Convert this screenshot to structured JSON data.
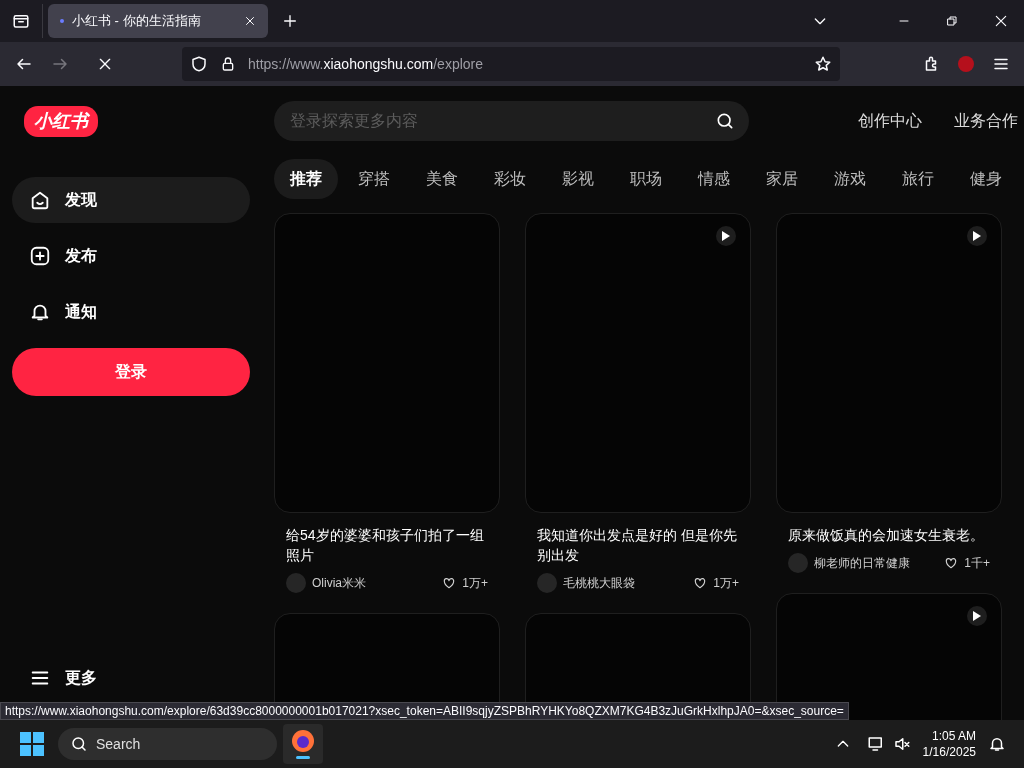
{
  "browser": {
    "tabs": [
      {
        "title": "小红书 - 你的生活指南",
        "selected": true,
        "loading": true
      }
    ],
    "url_prefix": "https://www.",
    "url_domain": "xiaohongshu.com",
    "url_path": "/explore",
    "status_url": "https://www.xiaohongshu.com/explore/63d39cc8000000001b017021?xsec_token=ABII9sqjyZSPBhRYHKYo8QZXM7KG4B3zJuGrkHxlhpJA0=&xsec_source="
  },
  "site": {
    "logo": "小红书",
    "search": {
      "placeholder": "登录探索更多内容"
    },
    "header_links": [
      "创作中心",
      "业务合作"
    ],
    "nav": [
      {
        "label": "发现",
        "kind": "discover",
        "selected": true
      },
      {
        "label": "发布",
        "kind": "publish",
        "selected": false
      },
      {
        "label": "通知",
        "kind": "notify",
        "selected": false
      }
    ],
    "login_button": "登录",
    "more": "更多",
    "channels": [
      {
        "label": "推荐",
        "selected": true
      },
      {
        "label": "穿搭",
        "selected": false
      },
      {
        "label": "美食",
        "selected": false
      },
      {
        "label": "彩妆",
        "selected": false
      },
      {
        "label": "影视",
        "selected": false
      },
      {
        "label": "职场",
        "selected": false
      },
      {
        "label": "情感",
        "selected": false
      },
      {
        "label": "家居",
        "selected": false
      },
      {
        "label": "游戏",
        "selected": false
      },
      {
        "label": "旅行",
        "selected": false
      },
      {
        "label": "健身",
        "selected": false
      }
    ],
    "columns": [
      [
        {
          "video": false,
          "title": "给54岁的婆婆和孩子们拍了一组照片",
          "author": "Olivia米米",
          "likes": "1万+"
        },
        {
          "video": false
        }
      ],
      [
        {
          "video": true,
          "title": "我知道你出发点是好的 但是你先别出发",
          "author": "毛桃桃大眼袋",
          "likes": "1万+"
        },
        {
          "video": false
        }
      ],
      [
        {
          "video": true,
          "title": "原来做饭真的会加速女生衰老。",
          "author": "柳老师的日常健康",
          "likes": "1千+"
        },
        {
          "video": true
        }
      ]
    ]
  },
  "taskbar": {
    "search": "Search",
    "time": "1:05 AM",
    "date": "1/16/2025"
  }
}
